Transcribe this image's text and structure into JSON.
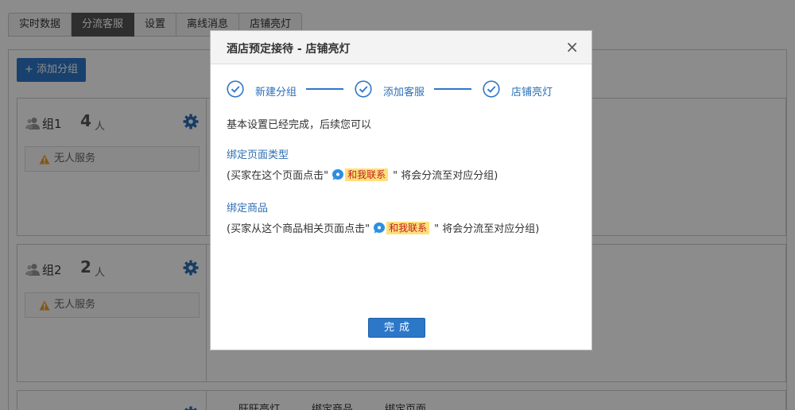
{
  "tabs": [
    {
      "label": "实时数据",
      "active": false
    },
    {
      "label": "分流客服",
      "active": true
    },
    {
      "label": "设置",
      "active": false
    },
    {
      "label": "离线消息",
      "active": false
    },
    {
      "label": "店铺亮灯",
      "active": false
    }
  ],
  "add_group_label": "+ 添加分组",
  "groups": [
    {
      "name": "组1",
      "count": "4",
      "unit": "人",
      "status": "无人服务"
    },
    {
      "name": "组2",
      "count": "2",
      "unit": "人",
      "status": "无人服务"
    }
  ],
  "bottom_tabs": [
    "旺旺亮灯",
    "绑定商品",
    "绑定页面"
  ],
  "modal": {
    "title": "酒店预定接待 - 店铺亮灯",
    "close": "×",
    "steps": [
      "新建分组",
      "添加客服",
      "店铺亮灯"
    ],
    "intro": "基本设置已经完成，后续您可以",
    "section1_title": "绑定页面类型",
    "section1_prefix": "(买家在这个页面点击\"",
    "section1_suffix": "\" 将会分流至对应分组)",
    "section2_title": "绑定商品",
    "section2_prefix": "(买家从这个商品相关页面点击\"",
    "section2_suffix": "\" 将会分流至对应分组)",
    "contact_label": "和我联系",
    "done_label": "完成"
  },
  "colors": {
    "accent": "#2d77c9",
    "link": "#2d6fb5",
    "warning": "#f0a020",
    "badge_bg": "#ffe07a"
  }
}
